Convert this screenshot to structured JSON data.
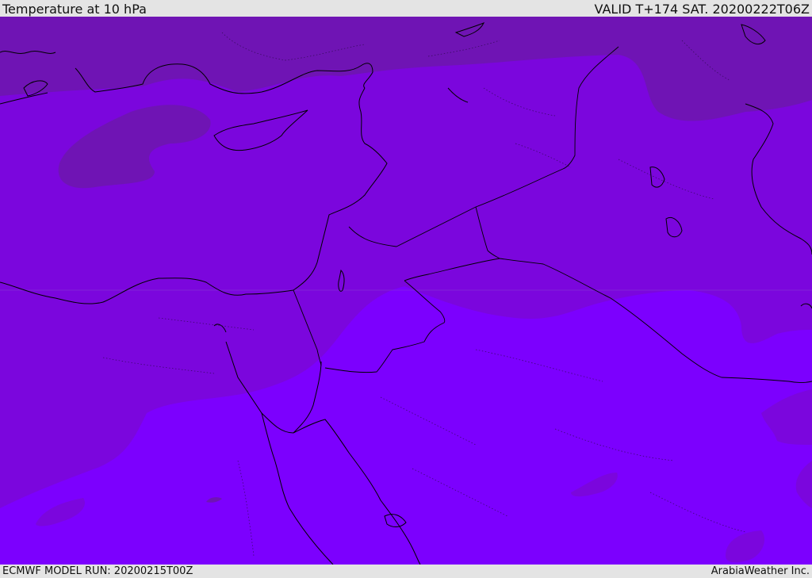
{
  "header": {
    "title": "Temperature at 10 hPa",
    "valid_time": "VALID T+174 SAT. 20200222T06Z"
  },
  "footer": {
    "model_run": "ECMWF MODEL RUN: 20200215T00Z",
    "credit": "ArabiaWeather Inc."
  },
  "map": {
    "colors": {
      "band_cold": "#6f14b4",
      "band_mid": "#7b06dd",
      "band_warm": "#7c00fe",
      "border": "#000000",
      "province_line": "#3a0a5a"
    }
  }
}
